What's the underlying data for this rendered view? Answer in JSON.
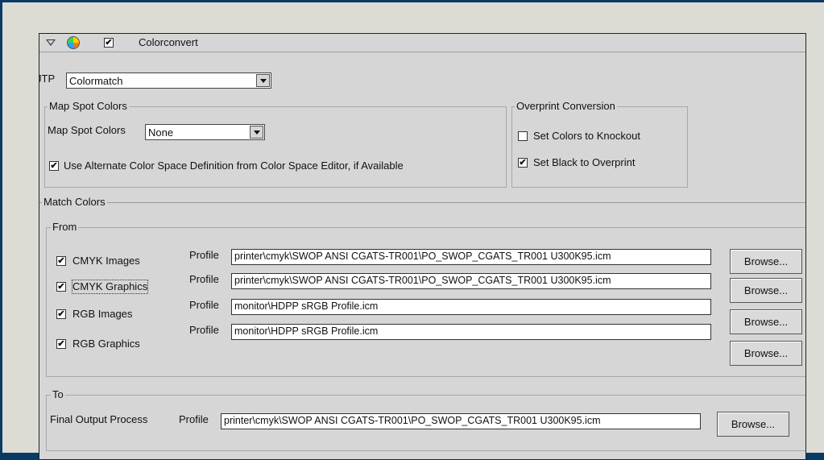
{
  "header": {
    "title": "Colorconvert",
    "enabled": true
  },
  "jtp": {
    "label": "JTP",
    "selected": "Colormatch"
  },
  "map_spot": {
    "group_title": "Map Spot Colors",
    "label": "Map Spot Colors",
    "selected": "None",
    "alternate_label": "Use Alternate Color Space Definition from Color Space Editor, if Available",
    "alternate_checked": true
  },
  "overprint": {
    "group_title": "Overprint Conversion",
    "knockout_label": "Set Colors to Knockout",
    "knockout_checked": false,
    "black_label": "Set Black to Overprint",
    "black_checked": true
  },
  "match_colors": {
    "title": "Match Colors",
    "from_title": "From",
    "profile_label": "Profile",
    "browse_label": "Browse...",
    "rows": [
      {
        "label": "CMYK Images",
        "checked": true,
        "profile": "printer\\cmyk\\SWOP ANSI CGATS-TR001\\PO_SWOP_CGATS_TR001 U300K95.icm"
      },
      {
        "label": "CMYK Graphics",
        "checked": true,
        "profile": "printer\\cmyk\\SWOP ANSI CGATS-TR001\\PO_SWOP_CGATS_TR001 U300K95.icm"
      },
      {
        "label": "RGB Images",
        "checked": true,
        "profile": "monitor\\HDPP sRGB Profile.icm"
      },
      {
        "label": "RGB Graphics",
        "checked": true,
        "profile": "monitor\\HDPP sRGB Profile.icm"
      }
    ]
  },
  "to": {
    "title": "To",
    "label": "Final Output Process",
    "profile_label": "Profile",
    "profile": "printer\\cmyk\\SWOP ANSI CGATS-TR001\\PO_SWOP_CGATS_TR001 U300K95.icm",
    "browse_label": "Browse..."
  },
  "glyphs": {
    "check": "✔"
  }
}
